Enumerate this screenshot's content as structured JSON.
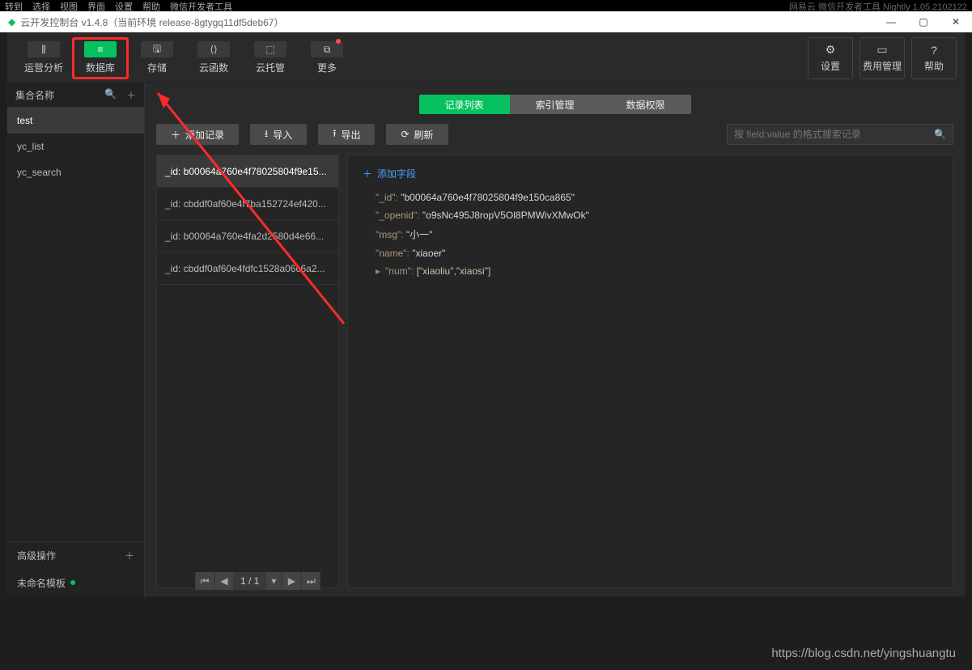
{
  "menubar": [
    "转到",
    "选择",
    "视图",
    "界面",
    "设置",
    "帮助",
    "微信开发者工具"
  ],
  "titlebar_faint": "网易云    微信开发者工具 Nightly 1.05.2102122",
  "title": "云开发控制台 v1.4.8（当前环境 release-8gtygq11df5deb67）",
  "toolbar": [
    {
      "label": "运营分析",
      "key": "analytics"
    },
    {
      "label": "数据库",
      "key": "db",
      "highlight": true
    },
    {
      "label": "存储",
      "key": "storage"
    },
    {
      "label": "云函数",
      "key": "func"
    },
    {
      "label": "云托管",
      "key": "host"
    },
    {
      "label": "更多",
      "key": "more",
      "dot": true
    }
  ],
  "toolbar_right": [
    {
      "label": "设置",
      "key": "settings",
      "icon": "⚙"
    },
    {
      "label": "费用管理",
      "key": "billing",
      "icon": "▭"
    },
    {
      "label": "帮助",
      "key": "help",
      "icon": "?"
    }
  ],
  "sidebar": {
    "title": "集合名称",
    "items": [
      "test",
      "yc_list",
      "yc_search"
    ],
    "active": 0,
    "advanced": "高级操作",
    "template": "未命名模板"
  },
  "segments": [
    "记录列表",
    "索引管理",
    "数据权限"
  ],
  "segment_active": 0,
  "buttons": {
    "add": "添加记录",
    "import": "导入",
    "export": "导出",
    "refresh": "刷新"
  },
  "search_placeholder": "按 field:value 的格式搜索记录",
  "records": [
    "_id: b00064a760e4f78025804f9e15...",
    "_id: cbddf0af60e4f7ba152724ef420...",
    "_id: b00064a760e4fa2d2580d4e66...",
    "_id: cbddf0af60e4fdfc1528a06c6a2..."
  ],
  "record_active": 0,
  "add_field": "添加字段",
  "doc": {
    "_id": "b00064a760e4f78025804f9e150ca865",
    "_openid": "o9sNc495J8ropV5Ol8PMWivXMwOk",
    "msg": "小一",
    "name": "xiaoer",
    "num": "[\"xiaoliu\",\"xiaosi\"]"
  },
  "pager": "1 / 1",
  "watermark": "https://blog.csdn.net/yingshuangtu"
}
